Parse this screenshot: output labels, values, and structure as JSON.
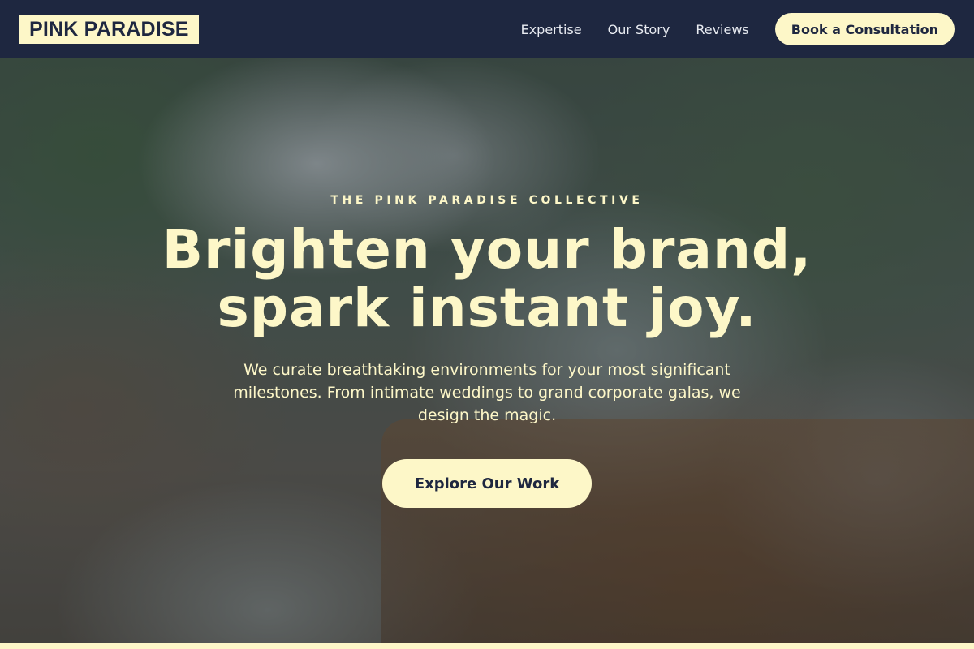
{
  "header": {
    "logo": "PINK PARADISE",
    "nav_links": [
      "Expertise",
      "Our Story",
      "Reviews"
    ],
    "cta_label": "Book a Consultation"
  },
  "hero": {
    "eyebrow": "THE PINK PARADISE COLLECTIVE",
    "headline_line1": "Brighten your brand,",
    "headline_line2": "spark instant joy.",
    "subtext": "We curate breathtaking environments for your most significant milestones. From intimate weddings to grand corporate galas, we design the magic.",
    "cta_label": "Explore Our Work"
  },
  "colors": {
    "navy": "#1e2740",
    "cream": "#fdf7c8"
  }
}
